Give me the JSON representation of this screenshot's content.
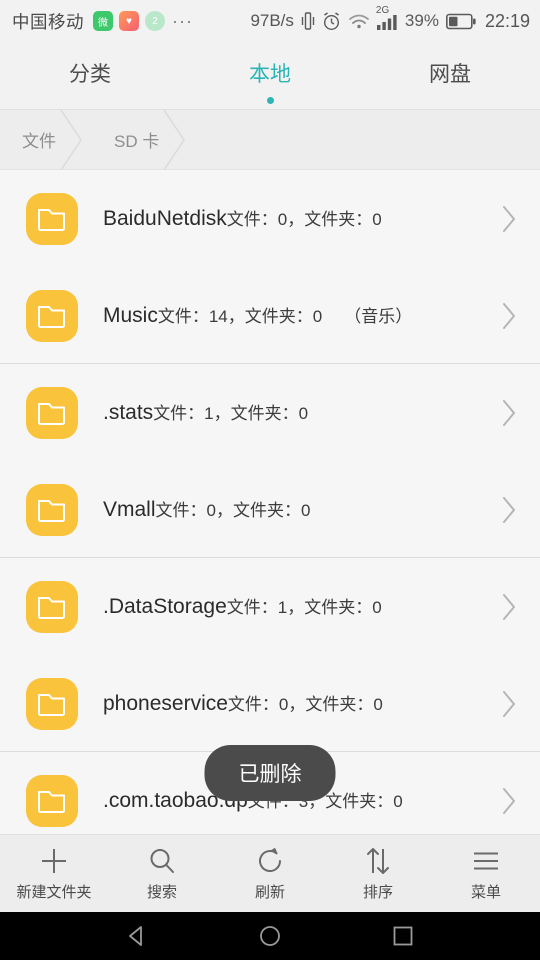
{
  "status_bar": {
    "carrier": "中国移动",
    "app_badges": [
      {
        "name": "wechat-badge-icon",
        "glyph": "微"
      },
      {
        "name": "heart-badge-icon",
        "glyph": "♥"
      },
      {
        "name": "qq-badge-icon",
        "glyph": "2"
      }
    ],
    "overflow_dots": "···",
    "network_speed": "97B/s",
    "vibrate_icon": "vibrate-icon",
    "alarm_icon": "alarm-icon",
    "wifi_icon": "wifi-icon",
    "signal_label": "2G",
    "signal_icon": "signal-bars-icon",
    "battery_percent": "39%",
    "battery_icon": "battery-icon",
    "clock": "22:19"
  },
  "tabs": [
    {
      "label": "分类",
      "active": false
    },
    {
      "label": "本地",
      "active": true
    },
    {
      "label": "网盘",
      "active": false
    }
  ],
  "breadcrumb": [
    {
      "label": "文件"
    },
    {
      "label": "SD 卡"
    }
  ],
  "file_list": {
    "sub_prefix_files": "文件：",
    "sub_prefix_folders": "文件夹：",
    "rows": [
      {
        "title": "BaiduNetdisk",
        "subtitle": "文件：0，文件夹：0",
        "alias": "",
        "separator_after": false
      },
      {
        "title": "Music",
        "subtitle": "文件：14，文件夹：0",
        "alias": "（音乐）",
        "separator_after": true
      },
      {
        "title": ".stats",
        "subtitle": "文件：1，文件夹：0",
        "alias": "",
        "separator_after": false
      },
      {
        "title": "Vmall",
        "subtitle": "文件：0，文件夹：0",
        "alias": "",
        "separator_after": true
      },
      {
        "title": ".DataStorage",
        "subtitle": "文件：1，文件夹：0",
        "alias": "",
        "separator_after": false
      },
      {
        "title": "phoneservice",
        "subtitle": "文件：0，文件夹：0",
        "alias": "",
        "separator_after": true
      },
      {
        "title": ".com.taobao.dp",
        "subtitle": "文件：3，文件夹：0",
        "alias": "",
        "separator_after": false
      }
    ]
  },
  "toast": {
    "message": "已删除"
  },
  "toolbar": [
    {
      "label": "新建文件夹",
      "icon": "plus-icon"
    },
    {
      "label": "搜索",
      "icon": "search-icon"
    },
    {
      "label": "刷新",
      "icon": "refresh-icon"
    },
    {
      "label": "排序",
      "icon": "sort-icon"
    },
    {
      "label": "菜单",
      "icon": "menu-icon"
    }
  ],
  "nav_bar": [
    {
      "name": "back-button",
      "icon": "triangle-back-icon"
    },
    {
      "name": "home-button",
      "icon": "circle-home-icon"
    },
    {
      "name": "recents-button",
      "icon": "square-recents-icon"
    }
  ],
  "colors": {
    "accent_teal": "#2bb5b5",
    "folder_yellow": "#fac33c",
    "page_bg": "#f6f6f6",
    "toast_bg": "#4b4b4b"
  }
}
